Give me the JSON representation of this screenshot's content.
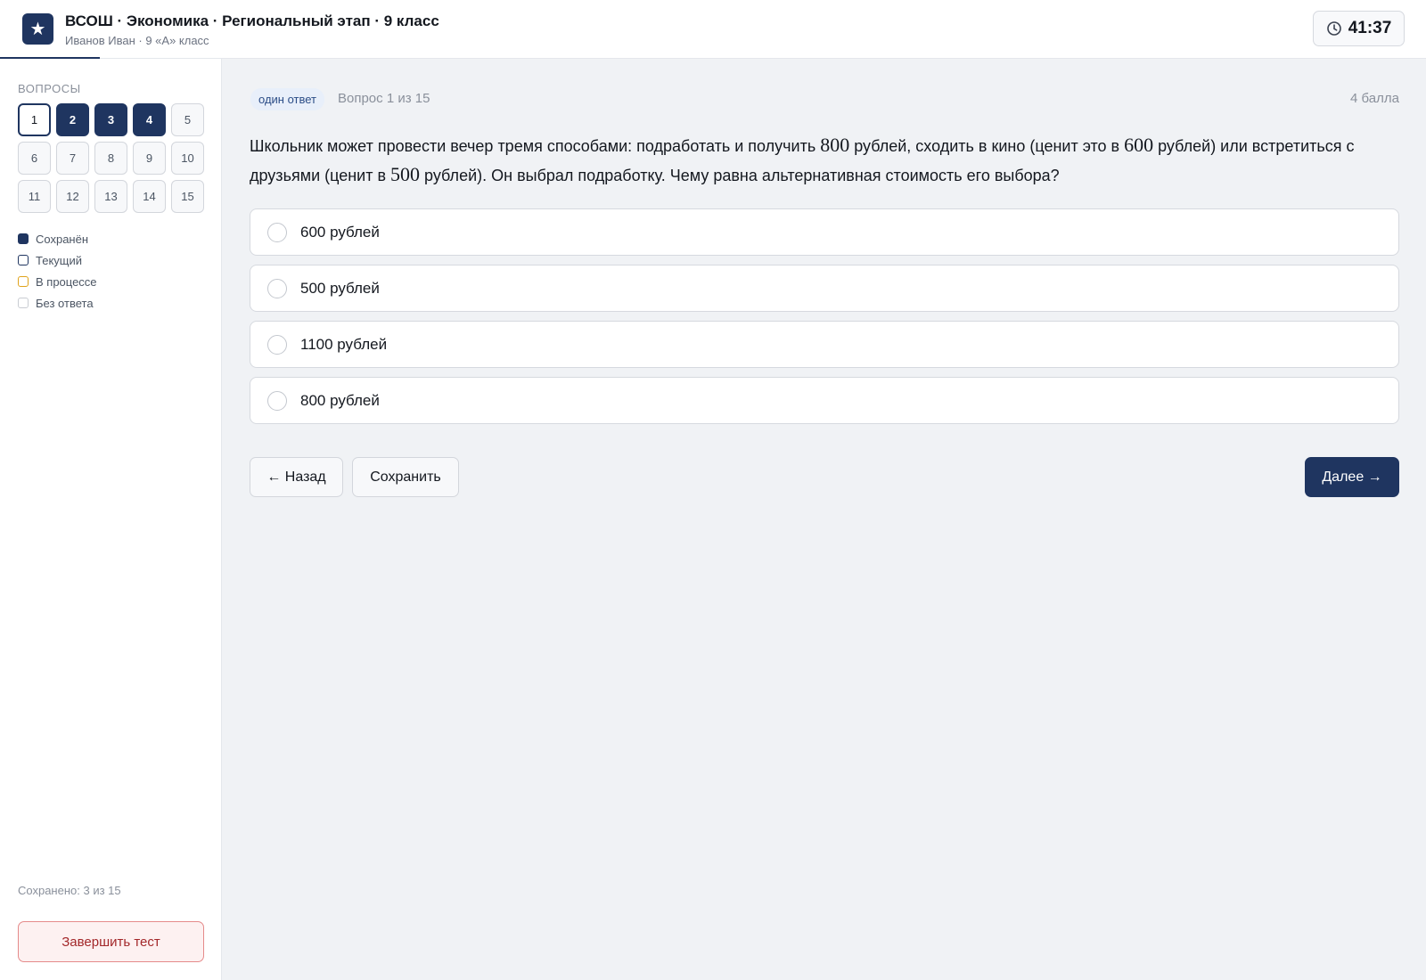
{
  "header": {
    "logo_glyph": "★",
    "title": "ВСОШ · Экономика · Региональный этап · 9 класс",
    "subtitle": "Иванов Иван · 9 «А» класс",
    "timer": "41:37"
  },
  "sidebar": {
    "heading": "ВОПРОСЫ",
    "questions": [
      {
        "n": "1",
        "status": "current"
      },
      {
        "n": "2",
        "status": "saved"
      },
      {
        "n": "3",
        "status": "saved"
      },
      {
        "n": "4",
        "status": "saved"
      },
      {
        "n": "5",
        "status": "none"
      },
      {
        "n": "6",
        "status": "none"
      },
      {
        "n": "7",
        "status": "none"
      },
      {
        "n": "8",
        "status": "none"
      },
      {
        "n": "9",
        "status": "none"
      },
      {
        "n": "10",
        "status": "none"
      },
      {
        "n": "11",
        "status": "none"
      },
      {
        "n": "12",
        "status": "none"
      },
      {
        "n": "13",
        "status": "none"
      },
      {
        "n": "14",
        "status": "none"
      },
      {
        "n": "15",
        "status": "none"
      }
    ],
    "legend": {
      "saved": "Сохранён",
      "current": "Текущий",
      "in_progress": "В процессе",
      "no_answer": "Без ответа"
    },
    "saved_count": "Сохранено: 3 из 15",
    "finish_label": "Завершить тест"
  },
  "question": {
    "type_tag": "один ответ",
    "number_text": "Вопрос 1 из 15",
    "points": "4 балла",
    "text_parts": {
      "p1": "Школьник может провести вечер тремя способами: подработать и получить ",
      "n1": "800",
      "p2": " рублей, сходить в кино (ценит это в ",
      "n2": "600",
      "p3": " рублей) или встретиться с друзьями (ценит в ",
      "n3": "500",
      "p4": " рублей). Он выбрал подработку. Чему равна альтернативная стоимость его выбора?"
    },
    "options": [
      "600 рублей",
      "500 рублей",
      "1100 рублей",
      "800 рублей"
    ]
  },
  "nav": {
    "back_label": "← Назад",
    "save_label": "Сохранить",
    "next_label": "Далее →"
  },
  "colors": {
    "brand": "#1f3560",
    "in_progress": "#e0a31b",
    "danger": "#a3282a"
  }
}
